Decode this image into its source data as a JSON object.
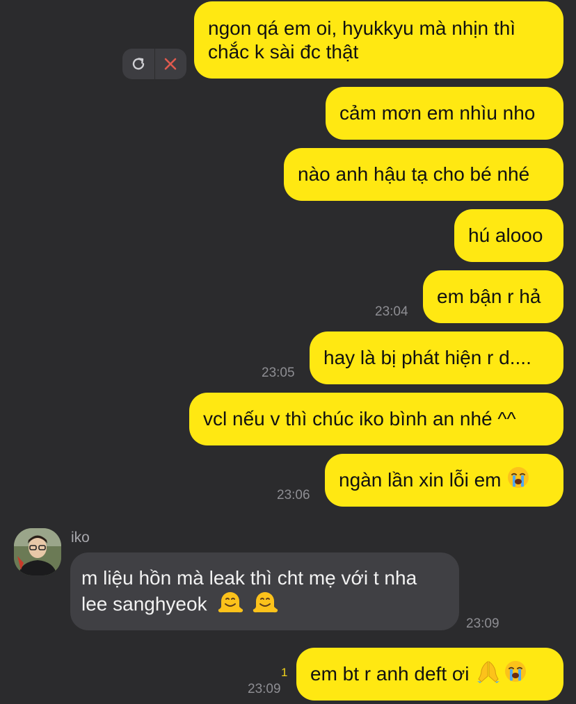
{
  "colors": {
    "background": "#2b2b2d",
    "outgoing_bubble": "#ffe812",
    "incoming_bubble": "#404044",
    "timestamp": "#8e8e93",
    "unread": "#f2d31b"
  },
  "failed_actions": {
    "retry_icon": "retry-icon",
    "cancel_icon": "close-icon"
  },
  "messages": [
    {
      "text": "ngon qá em oi, hyukkyu mà nhịn thì chắc k sài đc thật"
    },
    {
      "text": "cảm mơn em nhìu nho"
    },
    {
      "text": "nào anh hậu tạ cho bé nhé"
    },
    {
      "text": "hú alooo"
    },
    {
      "text": "em bận r hả",
      "time": "23:04"
    },
    {
      "text": "hay là bị phát hiện r d....",
      "time": "23:05"
    },
    {
      "text": "vcl nếu v thì chúc iko bình an nhé ^^"
    },
    {
      "text": "ngàn lần xin lỗi em",
      "emoji": "loudly-crying-face",
      "time": "23:06"
    },
    {
      "sender": "iko",
      "text": "m liệu hồn mà leak thì cht mẹ với t nha lee sanghyeok",
      "emoji": "melting-face x2",
      "time": "23:09"
    },
    {
      "text": "em bt r anh deft ơi",
      "emoji": "folded-hands, loudly-crying-face",
      "time": "23:09",
      "unread": "1"
    }
  ]
}
